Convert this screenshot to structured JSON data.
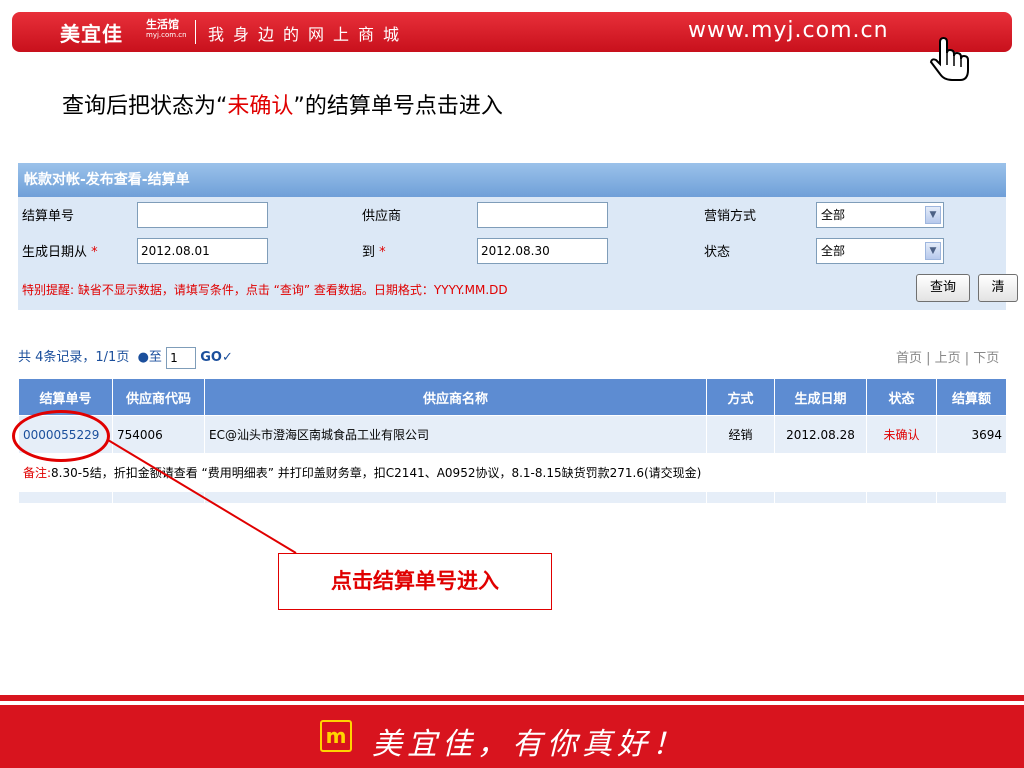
{
  "banner": {
    "brand": "美宜佳",
    "brand_sub1": "生活馆",
    "brand_sub2": "myj.com.cn",
    "slogan": "我身边的网上商城",
    "site_url": "www.myj.com.cn",
    "cursor_icon": "hand-pointer-icon"
  },
  "instruction": {
    "prefix": "查询后把状态为“",
    "highlight": "未确认",
    "suffix": "”的结算单号点击进入"
  },
  "panel": {
    "title": "帐款对帐-发布查看-结算单",
    "settlement_no_label": "结算单号",
    "settlement_no_value": "",
    "supplier_label": "供应商",
    "supplier_value": "",
    "sales_mode_label": "营销方式",
    "sales_mode_value": "全部",
    "date_from_label": "生成日期从",
    "date_from_required": "*",
    "date_from_value": "2012.08.01",
    "date_to_label": "到",
    "date_to_required": "*",
    "date_to_value": "2012.08.30",
    "status_label": "状态",
    "status_value": "全部",
    "hint": "特别提醒: 缺省不显示数据，请填写条件，点击 “查询” 查看数据。日期格式：YYYY.MM.DD",
    "query_button": "查询",
    "clear_button": "清"
  },
  "records": {
    "summary": "共 4条记录，1/1页",
    "goto_prefix": "●至",
    "page_input": "1",
    "go_label": "GO✓",
    "pager": "首页 | 上页 | 下页"
  },
  "table": {
    "headers": [
      "结算单号",
      "供应商代码",
      "供应商名称",
      "方式",
      "生成日期",
      "状态",
      "结算额"
    ],
    "row1": {
      "settlement_no": "0000055229",
      "supplier_code": "754006",
      "supplier_name": "EC@汕头市澄海区南城食品工业有限公司",
      "mode": "经销",
      "date": "2012.08.28",
      "status": "未确认",
      "amount": "3694"
    },
    "note_label": "备注:",
    "note_text": "8.30-5结，折扣金额请查看 “费用明细表” 并打印盖财务章，扣C2141、A0952协议，8.1-8.15缺货罚款271.6(请交现金)"
  },
  "callout": {
    "text": "点击结算单号进入"
  },
  "footer": {
    "logo_text": "m",
    "slogan": "美宜佳，有你真好！"
  },
  "colors": {
    "brand_red": "#d8141e",
    "header_blue": "#5d8cd2",
    "alert_red": "#e00000"
  }
}
